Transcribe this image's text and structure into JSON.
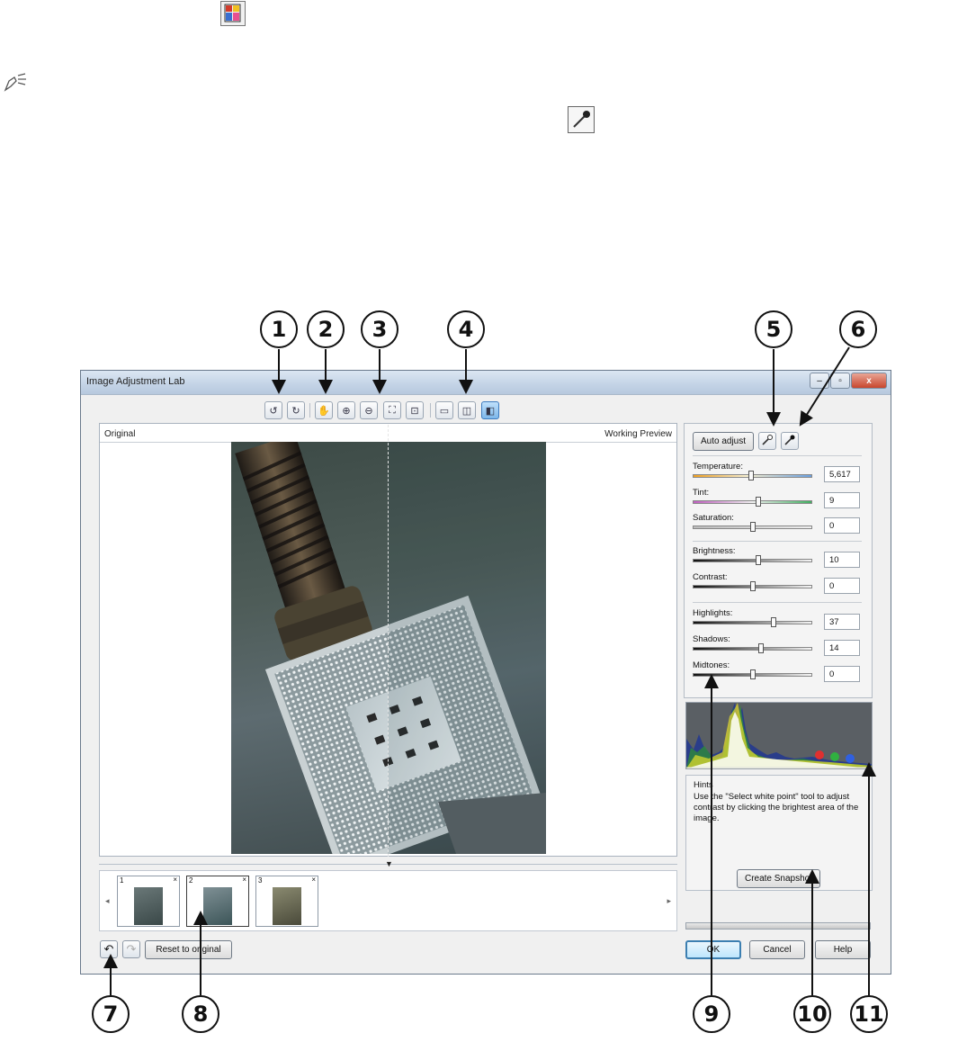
{
  "window": {
    "title": "Image Adjustment Lab",
    "close_glyph": "x",
    "max_glyph": "▫",
    "min_glyph": "–"
  },
  "top_icons": [
    "image-adjustment-lab-icon",
    "note-icon",
    "eyedropper-icon"
  ],
  "toolbar": {
    "buttons": [
      {
        "icon": "rotate-left-icon",
        "glyph": "↺"
      },
      {
        "icon": "rotate-right-icon",
        "glyph": "↻"
      },
      {
        "icon": "pan-hand-icon",
        "glyph": "✋"
      },
      {
        "icon": "zoom-in-icon",
        "glyph": "⊕"
      },
      {
        "icon": "zoom-out-icon",
        "glyph": "⊖"
      },
      {
        "icon": "fit-to-window-icon",
        "glyph": "⛶"
      },
      {
        "icon": "actual-size-icon",
        "glyph": "⊡"
      },
      {
        "icon": "full-preview-icon",
        "glyph": "▭"
      },
      {
        "icon": "split-preview-icon",
        "glyph": "◫"
      },
      {
        "icon": "split-before-after-icon",
        "glyph": "◧"
      }
    ]
  },
  "preview": {
    "left_label": "Original",
    "right_label": "Working Preview",
    "collapse_glyph": "▼"
  },
  "snapshots": {
    "left_arrow": "◂",
    "right_arrow": "▸",
    "items": [
      {
        "number": "1",
        "close": "×"
      },
      {
        "number": "2",
        "close": "×"
      },
      {
        "number": "3",
        "close": "×"
      }
    ]
  },
  "bottom_left": {
    "undo_glyph": "↶",
    "redo_glyph": "↷",
    "reset_label": "Reset to original"
  },
  "panel": {
    "auto_adjust_label": "Auto adjust",
    "white_point_icon": "eyedropper-white-icon",
    "black_point_icon": "eyedropper-black-icon",
    "sliders": [
      {
        "label": "Temperature:",
        "value": "5,617",
        "level": 0.49
      },
      {
        "label": "Tint:",
        "value": "9",
        "level": 0.55
      },
      {
        "label": "Saturation:",
        "value": "0",
        "level": 0.5
      },
      {
        "label": "Brightness:",
        "value": "10",
        "level": 0.55
      },
      {
        "label": "Contrast:",
        "value": "0",
        "level": 0.5
      },
      {
        "label": "Highlights:",
        "value": "37",
        "level": 0.68
      },
      {
        "label": "Shadows:",
        "value": "14",
        "level": 0.57
      },
      {
        "label": "Midtones:",
        "value": "0",
        "level": 0.5
      }
    ]
  },
  "hints": {
    "title": "Hints",
    "text": "Use the \"Select white point\" tool to adjust contrast by clicking the brightest area of the image.",
    "snapshot_label": "Create Snapshot"
  },
  "dialog_buttons": {
    "ok": "OK",
    "cancel": "Cancel",
    "help": "Help"
  },
  "callouts": [
    "1",
    "2",
    "3",
    "4",
    "5",
    "6",
    "7",
    "8",
    "9",
    "10",
    "11"
  ]
}
